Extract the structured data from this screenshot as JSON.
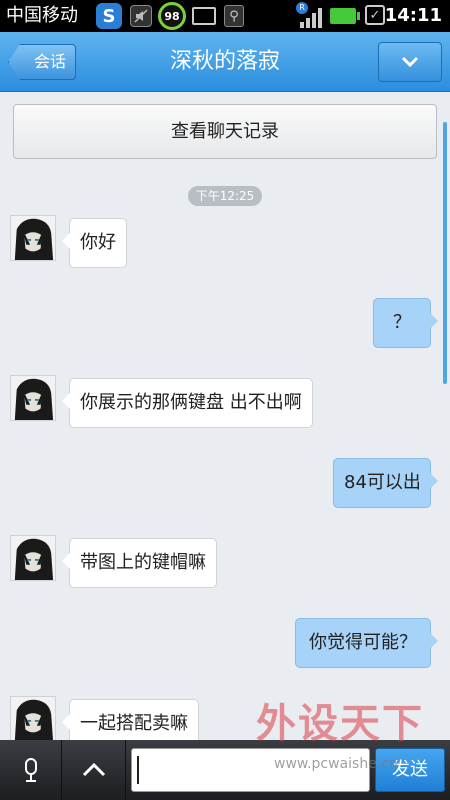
{
  "status_bar": {
    "carrier": "中国移动",
    "badge_98": "98",
    "time": "14:11",
    "icons": [
      "360-security-icon",
      "mute-icon",
      "98-badge-icon",
      "monitor-icon",
      "usb-icon",
      "signal-icon",
      "battery-icon",
      "check-icon"
    ]
  },
  "header": {
    "back_label": "会话",
    "title": "深秋的落寂",
    "menu_icon": "chevron-down-icon"
  },
  "chat": {
    "history_button": "查看聊天记录",
    "timestamp": "下午12:25",
    "messages": [
      {
        "from": "them",
        "text": "你好"
      },
      {
        "from": "me",
        "text": "？"
      },
      {
        "from": "them",
        "text": "你展示的那俩键盘 出不出啊"
      },
      {
        "from": "me",
        "text": "84可以出"
      },
      {
        "from": "them",
        "text": "带图上的键帽嘛"
      },
      {
        "from": "me",
        "text": "你觉得可能？"
      },
      {
        "from": "them",
        "text": "一起搭配卖嘛"
      }
    ]
  },
  "input_bar": {
    "voice_icon": "microphone-icon",
    "expand_icon": "chevron-up-icon",
    "input_value": "",
    "send_label": "发送"
  },
  "watermark": {
    "logo_text": "外设天下",
    "url": "www.pcwaishe.cn"
  },
  "colors": {
    "header_blue": "#2b8ede",
    "outgoing_bubble": "#a6d3f7",
    "incoming_bubble": "#ffffff",
    "chat_background": "#e9ecf0"
  }
}
